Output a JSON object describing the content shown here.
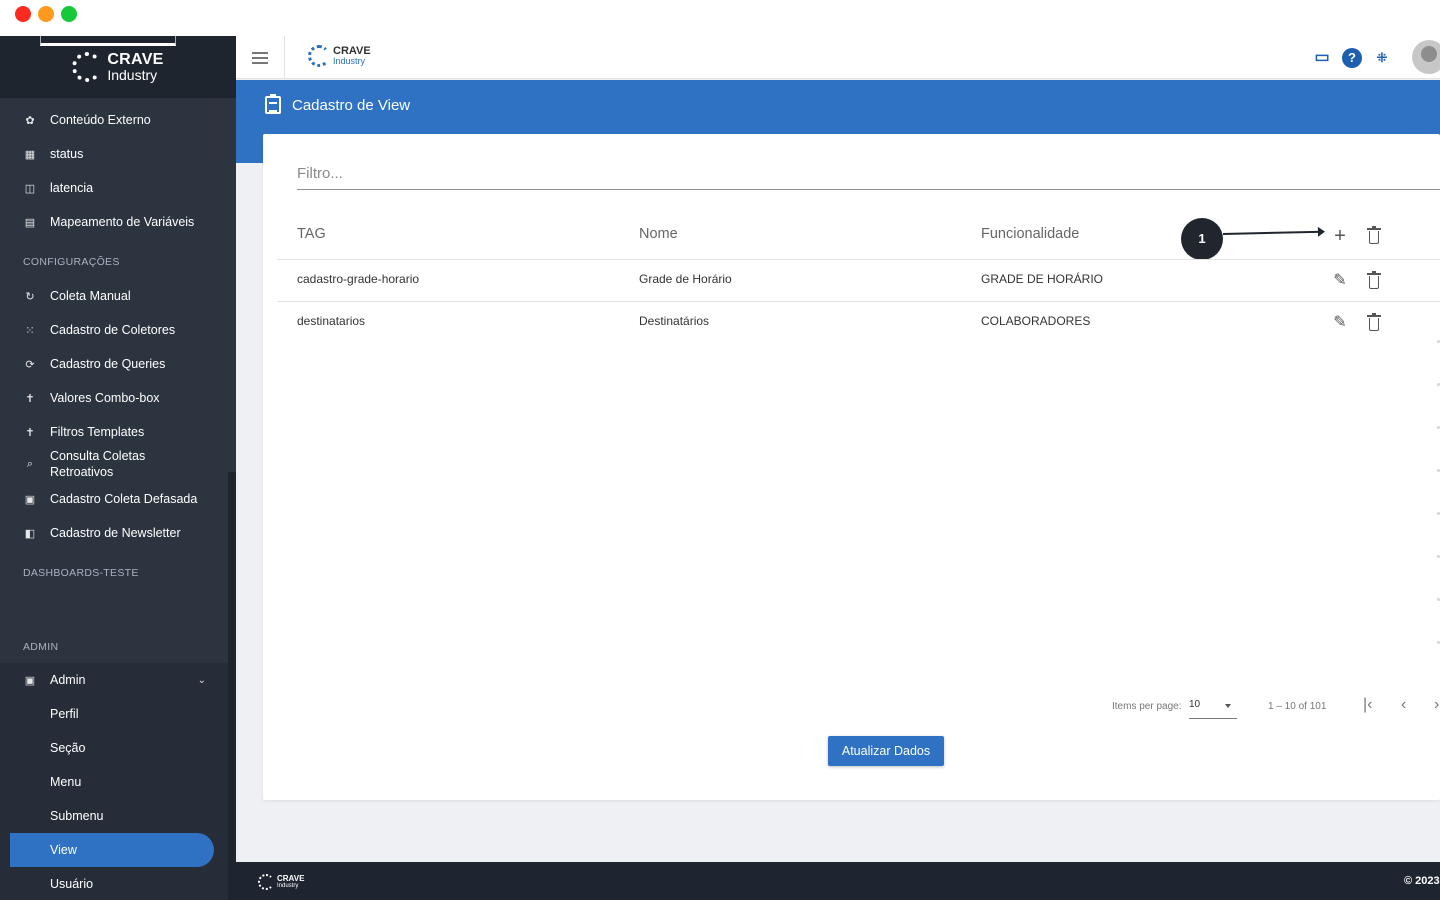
{
  "brand": {
    "name": "CRAVE",
    "sub": "Industry"
  },
  "sidebar": {
    "items": [
      {
        "label": "Conteúdo Externo",
        "icon": "puzzle-icon"
      },
      {
        "label": "status",
        "icon": "grid-icon"
      },
      {
        "label": "latencia",
        "icon": "clock-icon"
      },
      {
        "label": "Mapeamento de Variáveis",
        "icon": "list-icon"
      }
    ],
    "config_header": "CONFIGURAÇÕES",
    "config_items": [
      {
        "label": "Coleta Manual",
        "icon": "refresh-icon"
      },
      {
        "label": "Cadastro de Coletores",
        "icon": "grid-icon"
      },
      {
        "label": "Cadastro de Queries",
        "icon": "sync-icon"
      },
      {
        "label": "Valores Combo-box",
        "icon": "cross-icon"
      },
      {
        "label": "Filtros Templates",
        "icon": "cross-icon"
      },
      {
        "label": "Consulta Coletas Retroativos",
        "icon": "search-icon"
      },
      {
        "label": "Cadastro Coleta Defasada",
        "icon": "form-icon"
      },
      {
        "label": "Cadastro de Newsletter",
        "icon": "news-icon"
      }
    ],
    "dash_header": "DASHBOARDS-TESTE",
    "admin_header": "ADMIN",
    "admin_label": "Admin",
    "admin_sub": [
      "Perfil",
      "Seção",
      "Menu",
      "Submenu",
      "View",
      "Usuário"
    ]
  },
  "header": {
    "title": "Cadastro de View"
  },
  "filter": {
    "placeholder": "Filtro..."
  },
  "table": {
    "columns": [
      "TAG",
      "Nome",
      "Funcionalidade"
    ],
    "rows": [
      {
        "tag": "cadastro-grade-horario",
        "nome": "Grade de Horário",
        "func": "GRADE DE HORÁRIO"
      },
      {
        "tag": "destinatarios",
        "nome": "Destinatários",
        "func": "COLABORADORES"
      }
    ]
  },
  "callout": "1",
  "paginator": {
    "label": "Items per page:",
    "size": "10",
    "range": "1 – 10 of 101"
  },
  "update_button": "Atualizar Dados",
  "footer": {
    "copyright": "© 2023"
  }
}
